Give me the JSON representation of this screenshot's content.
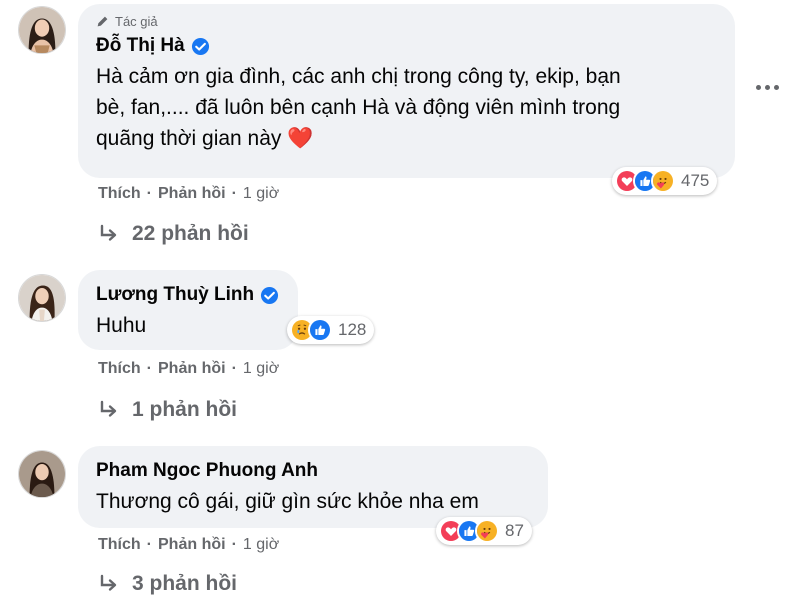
{
  "comments": [
    {
      "badge": "Tác giả",
      "author": "Đỗ Thị Hà",
      "verified": true,
      "text_lines": [
        "Hà cảm ơn gia đình, các anh chị trong công ty, ekip, bạn",
        "bè, fan,.... đã luôn bên cạnh Hà và động viên mình trong",
        "quãng thời gian này"
      ],
      "emoji": "❤️",
      "reactions": [
        "love",
        "like",
        "care"
      ],
      "reaction_count": "475",
      "actions": {
        "like": "Thích",
        "reply": "Phản hồi",
        "time": "1 giờ",
        "separator": "·"
      },
      "replies_label": "22 phản hồi"
    },
    {
      "author": "Lương Thuỳ Linh",
      "verified": true,
      "text_lines": [
        "Huhu"
      ],
      "reactions": [
        "sad",
        "like"
      ],
      "reaction_count": "128",
      "actions": {
        "like": "Thích",
        "reply": "Phản hồi",
        "time": "1 giờ",
        "separator": "·"
      },
      "replies_label": "1 phản hồi"
    },
    {
      "author": "Pham Ngoc Phuong Anh",
      "verified": false,
      "text_lines": [
        "Thương cô gái, giữ gìn sức khỏe nha em"
      ],
      "reactions": [
        "love",
        "like",
        "care"
      ],
      "reaction_count": "87",
      "actions": {
        "like": "Thích",
        "reply": "Phản hồi",
        "time": "1 giờ",
        "separator": "·"
      },
      "replies_label": "3 phản hồi"
    }
  ],
  "colors": {
    "bubble": "#f0f2f5",
    "secondary_text": "#65676b",
    "verified_blue": "#1877f2",
    "love": "#f33e58",
    "care": "#f7b125"
  },
  "icons": [
    "author-badge-pen-icon",
    "verified-icon",
    "reply-arrow-icon",
    "more-options-icon",
    "love-reaction-icon",
    "like-reaction-icon",
    "care-reaction-icon",
    "sad-reaction-icon"
  ]
}
